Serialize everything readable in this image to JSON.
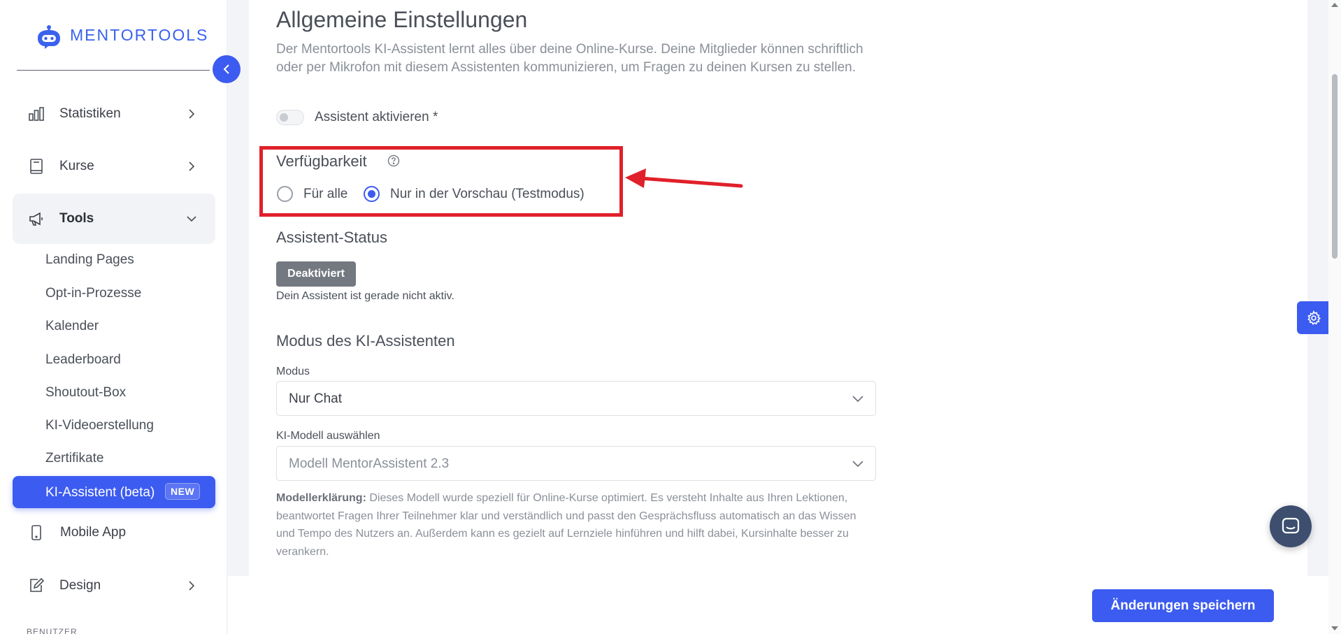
{
  "brand": {
    "name": "MENTORTOOLS"
  },
  "sidebar": {
    "items": [
      {
        "id": "statistiken",
        "label": "Statistiken",
        "icon": "bar-chart-icon",
        "expandable": true
      },
      {
        "id": "kurse",
        "label": "Kurse",
        "icon": "book-icon",
        "expandable": true
      },
      {
        "id": "tools",
        "label": "Tools",
        "icon": "megaphone-icon",
        "expanded": true
      }
    ],
    "subitems": [
      "Landing Pages",
      "Opt-in-Prozesse",
      "Kalender",
      "Leaderboard",
      "Shoutout-Box",
      "KI-Videoerstellung",
      "Zertifikate"
    ],
    "active_subitem": {
      "label": "KI-Assistent (beta)",
      "badge": "NEW"
    },
    "mobile_app": "Mobile App",
    "design": "Design",
    "section_benutzer": "BENUTZER"
  },
  "main": {
    "title": "Allgemeine Einstellungen",
    "description": "Der Mentortools KI-Assistent lernt alles über deine Online-Kurse. Deine Mitglieder können schriftlich oder per Mikrofon mit diesem Assistenten kommunizieren, um Fragen zu deinen Kursen zu stellen.",
    "activate_label": "Assistent aktivieren *",
    "activate_on": false,
    "availability": {
      "title": "Verfügbarkeit",
      "options": [
        "Für alle",
        "Nur in der Vorschau (Testmodus)"
      ],
      "selected": "Nur in der Vorschau (Testmodus)"
    },
    "status": {
      "title": "Assistent-Status",
      "badge": "Deaktiviert",
      "text": "Dein Assistent ist gerade nicht aktiv."
    },
    "mode": {
      "title": "Modus des KI-Assistenten",
      "mode_label": "Modus",
      "mode_value": "Nur Chat",
      "model_label": "KI-Modell auswählen",
      "model_value": "Modell MentorAssistent 2.3",
      "explain_bold": "Modellerklärung:",
      "explain_text": " Dieses Modell wurde speziell für Online-Kurse optimiert. Es versteht Inhalte aus Ihren Lektionen, beantwortet Fragen Ihrer Teilnehmer klar und verständlich und passt den Gesprächsfluss automatisch an das Wissen und Tempo des Nutzers an. Außerdem kann es gezielt auf Lernziele hinführen und hilft dabei, Kursinhalte besser zu verankern."
    },
    "save_label": "Änderungen speichern"
  },
  "colors": {
    "accent": "#3c5bf0",
    "annotation": "#e0202a",
    "badge_gray": "#737881"
  }
}
